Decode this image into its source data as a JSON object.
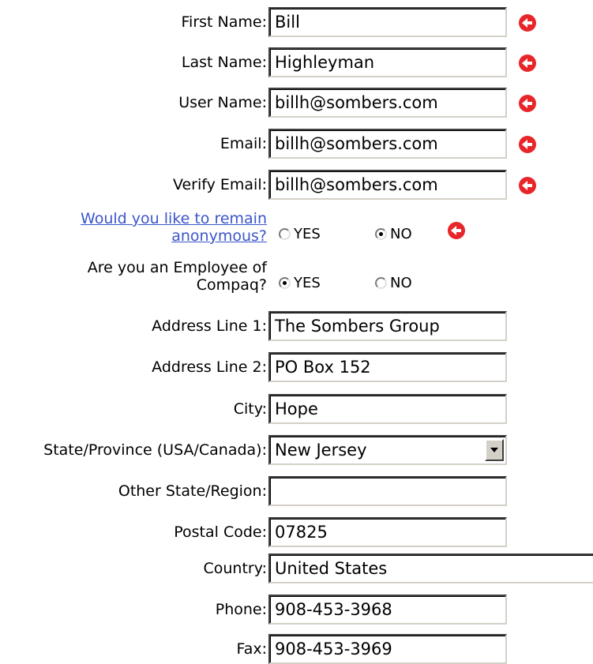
{
  "form": {
    "first_name": {
      "label": "First Name:",
      "value": "Bill",
      "required": true
    },
    "last_name": {
      "label": "Last Name:",
      "value": "Highleyman",
      "required": true
    },
    "user_name": {
      "label": "User Name:",
      "value": "billh@sombers.com",
      "required": true
    },
    "email": {
      "label": "Email:",
      "value": "billh@sombers.com",
      "required": true
    },
    "verify_email": {
      "label": "Verify Email:",
      "value": "billh@sombers.com",
      "required": true
    },
    "anonymous": {
      "label_line1": "Would you like to remain",
      "label_line2": "anonymous?",
      "options": [
        "YES",
        "NO"
      ],
      "selected": "NO",
      "required": true
    },
    "employee": {
      "label_line1": "Are you an Employee of",
      "label_line2": "Compaq?",
      "options": [
        "YES",
        "NO"
      ],
      "selected": "YES"
    },
    "address1": {
      "label": "Address Line 1:",
      "value": "The Sombers Group"
    },
    "address2": {
      "label": "Address Line 2:",
      "value": "PO Box 152"
    },
    "city": {
      "label": "City:",
      "value": "Hope"
    },
    "state": {
      "label": "State/Province (USA/Canada):",
      "value": "New Jersey"
    },
    "other_state": {
      "label": "Other State/Region:",
      "value": ""
    },
    "postal_code": {
      "label": "Postal Code:",
      "value": "07825"
    },
    "country": {
      "label": "Country:",
      "value": "United States"
    },
    "phone": {
      "label": "Phone:",
      "value": "908-453-3968"
    },
    "fax": {
      "label": "Fax:",
      "value": "908-453-3969"
    }
  },
  "colors": {
    "required_icon": "#e8262a",
    "link": "#3b56c9"
  }
}
